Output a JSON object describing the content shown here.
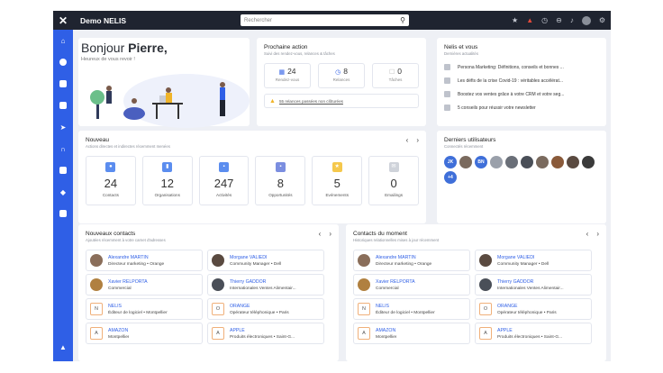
{
  "app": {
    "title": "Demo NELIS",
    "search_placeholder": "Rechercher"
  },
  "greeting": {
    "prefix": "Bonjour",
    "name": "Pierre,",
    "subtitle": "Heureux de vous revoir !"
  },
  "prochaine": {
    "title": "Prochaine action",
    "subtitle": "Suivi des rendez-vous, relances & tâches",
    "stats": [
      {
        "value": "24",
        "label": "Rendez-vous"
      },
      {
        "value": "8",
        "label": "Relances"
      },
      {
        "value": "0",
        "label": "Tâches"
      }
    ],
    "alert": "55 relances passées non clôturées"
  },
  "news": {
    "title": "Nelis et vous",
    "subtitle": "Dernières actualités",
    "items": [
      "Persona Marketing: Définitions, conseils et bonnes ...",
      "Les défis de la crise Covid-19 : véritables accélérat...",
      "Boostez vos ventes grâce à votre CRM et votre seg...",
      "5 conseils pour réussir votre newsletter"
    ]
  },
  "nouveau": {
    "title": "Nouveau",
    "subtitle": "Actions directes et indirectes récemment menées",
    "tiles": [
      {
        "value": "24",
        "label": "Contacts",
        "color": "#5b8def"
      },
      {
        "value": "12",
        "label": "Organisations",
        "color": "#5b8def"
      },
      {
        "value": "247",
        "label": "Activités",
        "color": "#5b8def"
      },
      {
        "value": "8",
        "label": "Opportunités",
        "color": "#7b8ee0"
      },
      {
        "value": "5",
        "label": "Evénements",
        "color": "#f5c84c"
      },
      {
        "value": "0",
        "label": "Emailings",
        "color": "#cfd3da"
      }
    ]
  },
  "users": {
    "title": "Derniers utilisateurs",
    "subtitle": "Connectés récemment",
    "initials": [
      "JK",
      "BN"
    ],
    "more": "+4"
  },
  "new_contacts": {
    "title": "Nouveaux contacts",
    "subtitle": "Ajoutées récemment à votre carnet d'adresses",
    "items": [
      {
        "name": "Alexandre MARTIN",
        "desc": "Directeur marketing • Orange",
        "type": "person"
      },
      {
        "name": "Morgane VALIEDI",
        "desc": "Community Manager • Dell",
        "type": "person"
      },
      {
        "name": "Xavier RELPORTA",
        "desc": "Commercial",
        "type": "person"
      },
      {
        "name": "Thierry GADDOR",
        "desc": "Internationales Ventes Alimentair...",
        "type": "person"
      },
      {
        "name": "NELIS",
        "desc": "Éditeur de logiciel • Montpellier",
        "type": "org",
        "initial": "N"
      },
      {
        "name": "ORANGE",
        "desc": "Opérateur téléphonique • Paris",
        "type": "org",
        "initial": "O"
      },
      {
        "name": "AMAZON",
        "desc": "Montpellier",
        "type": "org",
        "initial": "A"
      },
      {
        "name": "APPLE",
        "desc": "Produits électroniques • Saint-G...",
        "type": "org",
        "initial": "A"
      }
    ]
  },
  "moment_contacts": {
    "title": "Contacts du moment",
    "subtitle": "Historiques relationnelles mises à jour récemment",
    "items": [
      {
        "name": "Alexandre MARTIN",
        "desc": "Directeur marketing • Orange",
        "type": "person"
      },
      {
        "name": "Morgane VALIEDI",
        "desc": "Community Manager • Dell",
        "type": "person"
      },
      {
        "name": "Xavier RELPORTA",
        "desc": "Commercial",
        "type": "person"
      },
      {
        "name": "Thierry GADDOR",
        "desc": "Internationales Ventes Alimentair...",
        "type": "person"
      },
      {
        "name": "NELIS",
        "desc": "Éditeur de logiciel • Montpellier",
        "type": "org",
        "initial": "N"
      },
      {
        "name": "ORANGE",
        "desc": "Opérateur téléphonique • Paris",
        "type": "org",
        "initial": "O"
      },
      {
        "name": "AMAZON",
        "desc": "Montpellier",
        "type": "org",
        "initial": "A"
      },
      {
        "name": "APPLE",
        "desc": "Produits électroniques • Saint-G...",
        "type": "org",
        "initial": "A"
      }
    ]
  },
  "colors": {
    "accent": "#2f5fe6",
    "topbar": "#1f2430",
    "warning": "#e24a3b"
  }
}
